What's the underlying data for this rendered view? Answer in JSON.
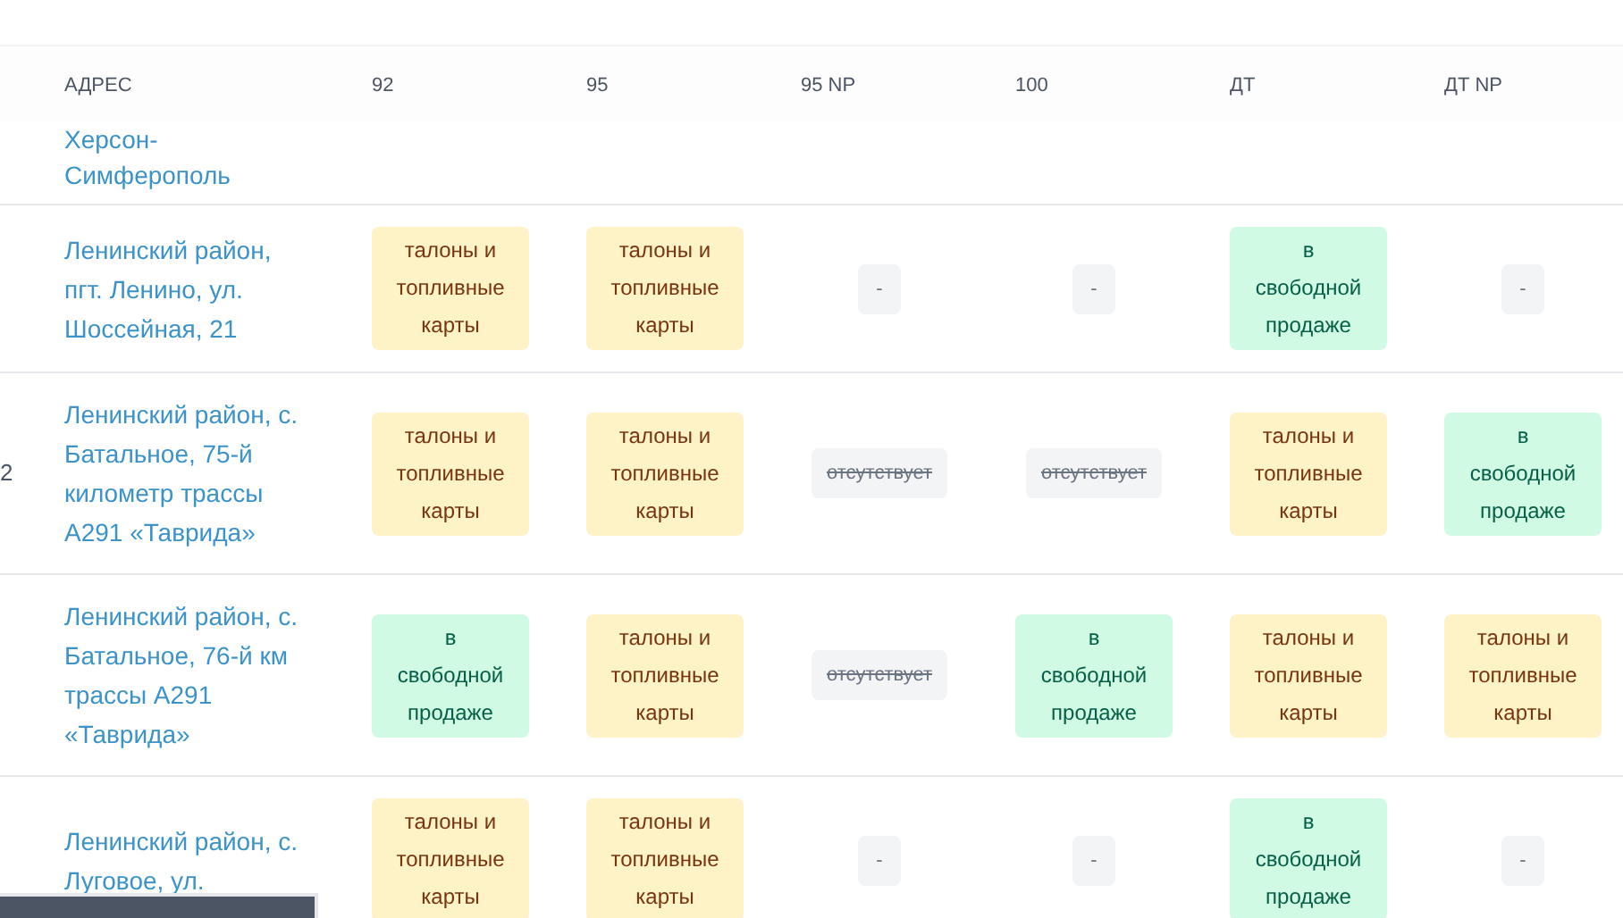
{
  "table": {
    "columns": [
      "АДРЕС",
      "92",
      "95",
      "95 NP",
      "100",
      "ДТ",
      "ДТ NP"
    ],
    "rows": [
      {
        "address": "Херсон-\nСимферополь",
        "cells": []
      },
      {
        "address": "Ленинский район, пгт. Ленино, ул. Шоссейная, 21",
        "cells": [
          {
            "kind": "coupons",
            "text": "талоны и топливные карты"
          },
          {
            "kind": "coupons",
            "text": "талоны и топливные карты"
          },
          {
            "kind": "none",
            "text": "-"
          },
          {
            "kind": "none",
            "text": "-"
          },
          {
            "kind": "free",
            "text": "в свободной продаже"
          },
          {
            "kind": "none",
            "text": "-"
          }
        ]
      },
      {
        "row_number": "2",
        "address": "Ленинский район, с. Батальное, 75-й километр трассы А291 «Таврида»",
        "cells": [
          {
            "kind": "coupons",
            "text": "талоны и топливные карты"
          },
          {
            "kind": "coupons",
            "text": "талоны и топливные карты"
          },
          {
            "kind": "absent",
            "text": "отсутствует"
          },
          {
            "kind": "absent",
            "text": "отсутствует"
          },
          {
            "kind": "coupons",
            "text": "талоны и топливные карты"
          },
          {
            "kind": "free",
            "text": "в свободной продаже"
          }
        ]
      },
      {
        "address": "Ленинский район, с. Батальное, 76-й км трассы А291 «Таврида»",
        "cells": [
          {
            "kind": "free",
            "text": "в свободной продаже"
          },
          {
            "kind": "coupons",
            "text": "талоны и топливные карты"
          },
          {
            "kind": "absent",
            "text": "отсутствует"
          },
          {
            "kind": "free",
            "text": "в свободной продаже"
          },
          {
            "kind": "coupons",
            "text": "талоны и топливные карты"
          },
          {
            "kind": "coupons",
            "text": "талоны и топливные карты"
          }
        ]
      },
      {
        "address": "Ленинский район, с. Луговое, ул.",
        "cells": [
          {
            "kind": "coupons",
            "text": "талоны и топливные карты"
          },
          {
            "kind": "coupons",
            "text": "талоны и топливные карты"
          },
          {
            "kind": "none",
            "text": "-"
          },
          {
            "kind": "none",
            "text": "-"
          },
          {
            "kind": "free",
            "text": "в свободной продаже"
          },
          {
            "kind": "none",
            "text": "-"
          }
        ]
      }
    ]
  }
}
